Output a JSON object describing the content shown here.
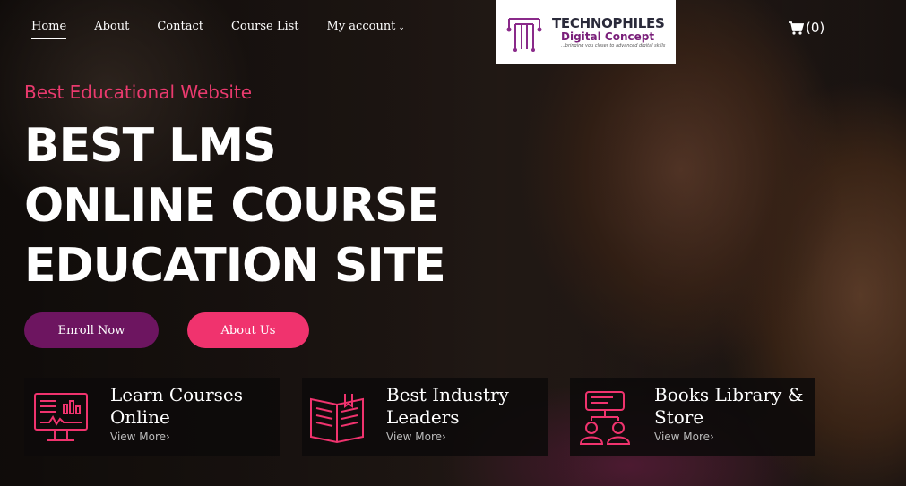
{
  "nav": {
    "items": [
      {
        "label": "Home",
        "active": true
      },
      {
        "label": "About"
      },
      {
        "label": "Contact"
      },
      {
        "label": "Course List"
      },
      {
        "label": "My account",
        "dropdown": true
      }
    ]
  },
  "logo": {
    "line1": "TECHNOPHILES",
    "line2": "Digital Concept",
    "tagline": "...bringing you closer to advanced digital skills"
  },
  "cart": {
    "label": "(0)",
    "icon": "cart-icon"
  },
  "hero": {
    "kicker": "Best Educational Website",
    "headline": [
      "BEST LMS",
      "ONLINE COURSE",
      "EDUCATION SITE"
    ]
  },
  "buttons": {
    "enroll": "Enroll Now",
    "about": "About Us"
  },
  "features": [
    {
      "title_line1": "Learn Courses",
      "title_line2": "Online",
      "more": "View More›",
      "icon": "monitor-chart-icon"
    },
    {
      "title_line1": "Best Industry",
      "title_line2": "Leaders",
      "more": "View More›",
      "icon": "open-book-icon"
    },
    {
      "title_line1": "Books Library &",
      "title_line2": "Store",
      "more": "View More›",
      "icon": "library-people-icon"
    }
  ],
  "colors": {
    "accent_pink": "#f0336e",
    "accent_purple": "#6d1560",
    "kicker": "#ea3a6e"
  }
}
